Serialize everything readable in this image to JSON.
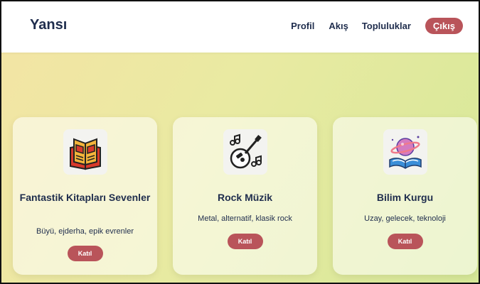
{
  "nav": {
    "brand": "Yansı",
    "links": [
      "Profil",
      "Akış",
      "Topluluklar"
    ],
    "logout_label": "Çıkış"
  },
  "colors": {
    "accent": "#b9545a",
    "text": "#1f2d4d"
  },
  "communities": [
    {
      "title": "Fantastik Kitapları Sevenler",
      "description": "Büyü, ejderha, epik evrenler",
      "join_label": "Katıl",
      "icon": "open-book-icon"
    },
    {
      "title": "Rock Müzik",
      "description": "Metal, alternatif, klasik rock",
      "join_label": "Katıl",
      "icon": "guitar-notes-icon"
    },
    {
      "title": "Bilim Kurgu",
      "description": "Uzay, gelecek, teknoloji",
      "join_label": "Katıl",
      "icon": "planet-book-icon"
    }
  ]
}
